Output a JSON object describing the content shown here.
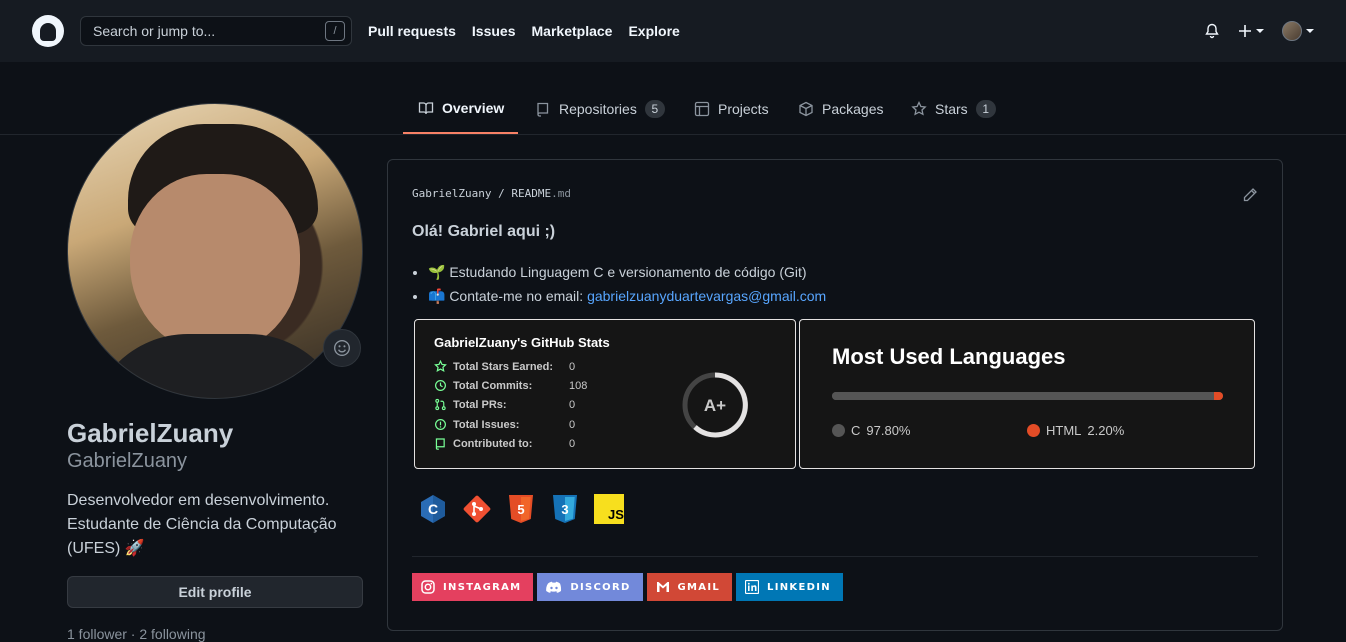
{
  "header": {
    "search_placeholder": "Search or jump to...",
    "search_shortcut": "/",
    "nav": [
      "Pull requests",
      "Issues",
      "Marketplace",
      "Explore"
    ]
  },
  "tabs": [
    {
      "label": "Overview",
      "icon": "book-icon",
      "active": true
    },
    {
      "label": "Repositories",
      "icon": "repo-icon",
      "count": "5"
    },
    {
      "label": "Projects",
      "icon": "project-icon"
    },
    {
      "label": "Packages",
      "icon": "package-icon"
    },
    {
      "label": "Stars",
      "icon": "star-icon",
      "count": "1"
    }
  ],
  "profile": {
    "name": "GabrielZuany",
    "login": "GabrielZuany",
    "bio_line1": "Desenvolvedor em desenvolvimento.",
    "bio_line2": "Estudante de Ciência da Computação",
    "bio_line3": "(UFES) 🚀",
    "edit_label": "Edit profile",
    "follow_text": "1 follower · 2 following"
  },
  "readme": {
    "owner": "GabrielZuany",
    "file_name": "README",
    "file_ext": ".md",
    "heading": "Olá! Gabriel aqui ;)",
    "item1": "🌱 Estudando Linguagem C e versionamento de código (Git)",
    "item2_prefix": "📫 Contate-me no email: ",
    "item2_email": "gabrielzuanyduartevargas@gmail.com"
  },
  "stats_card": {
    "title": "GabrielZuany's GitHub Stats",
    "rows": [
      {
        "label": "Total Stars Earned:",
        "value": "0"
      },
      {
        "label": "Total Commits:",
        "value": "108"
      },
      {
        "label": "Total PRs:",
        "value": "0"
      },
      {
        "label": "Total Issues:",
        "value": "0"
      },
      {
        "label": "Contributed to:",
        "value": "0"
      }
    ],
    "rank": "A+",
    "accent": "#79ff97"
  },
  "languages_card": {
    "title": "Most Used Languages",
    "languages": [
      {
        "name": "C",
        "percent": "97.80%",
        "fraction": 0.978,
        "color": "#555555"
      },
      {
        "name": "HTML",
        "percent": "2.20%",
        "fraction": 0.022,
        "color": "#e34c26"
      }
    ]
  },
  "tech_icons": [
    {
      "name": "c-logo-icon",
      "label": "C",
      "color": "#2a6cb5"
    },
    {
      "name": "git-logo-icon",
      "label": "",
      "color": "#f05032"
    },
    {
      "name": "html5-logo-icon",
      "label": "5",
      "color": "#e44d26"
    },
    {
      "name": "css3-logo-icon",
      "label": "3",
      "color": "#1572b6"
    },
    {
      "name": "js-logo-icon",
      "label": "JS",
      "color": "#f7df1e"
    }
  ],
  "social_badges": [
    {
      "label": "INSTAGRAM",
      "color": "#e4405f",
      "icon": "instagram-icon"
    },
    {
      "label": "DISCORD",
      "color": "#7289da",
      "icon": "discord-icon"
    },
    {
      "label": "GMAIL",
      "color": "#d14836",
      "icon": "gmail-icon"
    },
    {
      "label": "LINKEDIN",
      "color": "#0077b5",
      "icon": "linkedin-icon"
    }
  ]
}
